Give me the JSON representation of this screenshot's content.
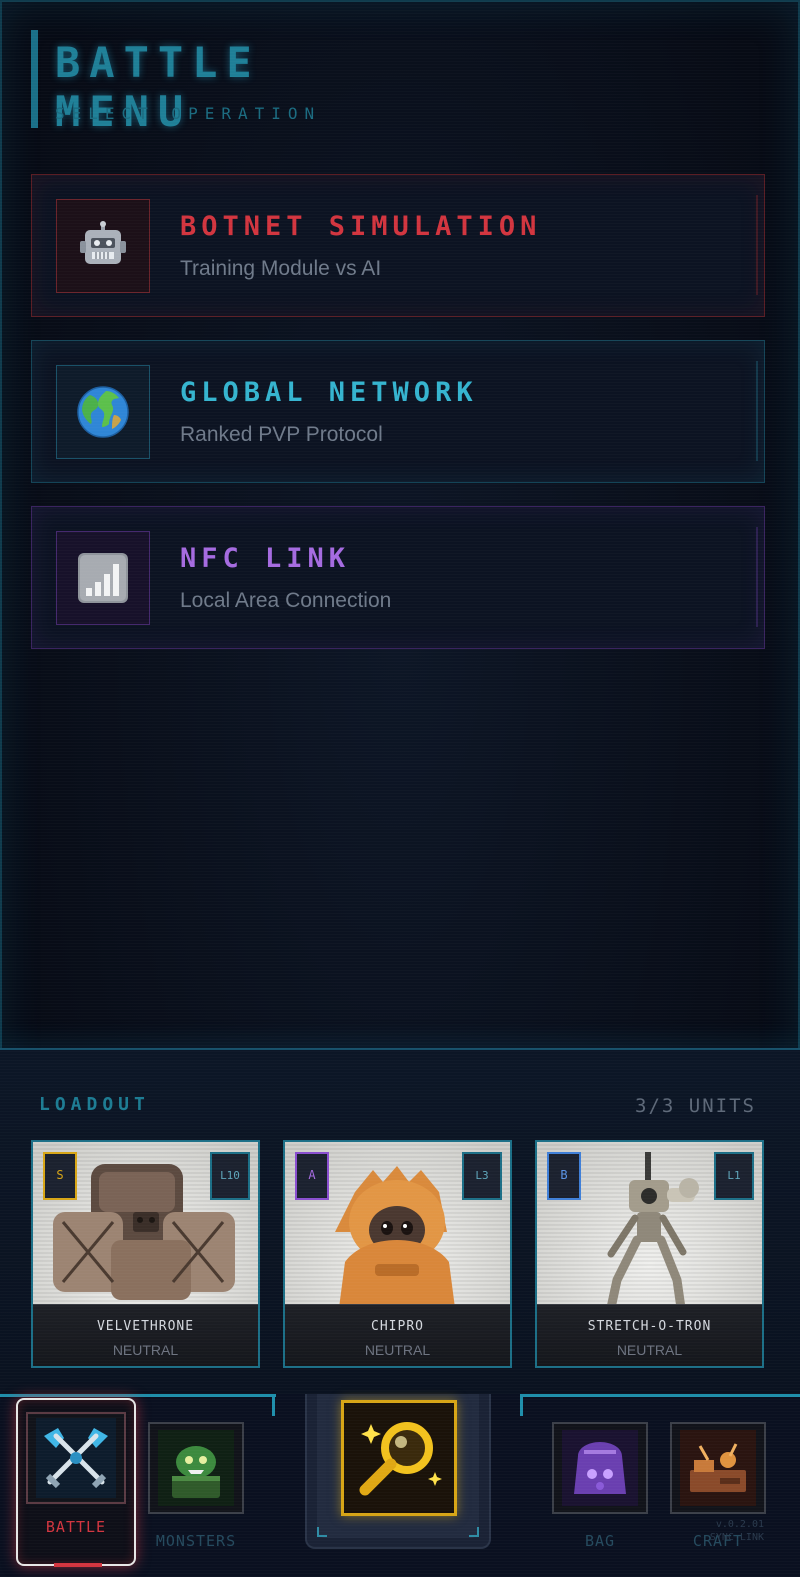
{
  "header": {
    "title": "BATTLE MENU",
    "subtitle": "SELECT OPERATION"
  },
  "modes": [
    {
      "title": "BOTNET SIMULATION",
      "desc": "Training Module vs AI",
      "icon": "robot-icon",
      "color": "#d2353f"
    },
    {
      "title": "GLOBAL NETWORK",
      "desc": "Ranked PVP Protocol",
      "icon": "globe-icon",
      "color": "#35b4cf"
    },
    {
      "title": "NFC LINK",
      "desc": "Local Area Connection",
      "icon": "signal-bars-icon",
      "color": "#a56be0"
    }
  ],
  "loadout": {
    "label": "LOADOUT",
    "count": "3/3 UNITS",
    "units": [
      {
        "rank": "S",
        "level": "L10",
        "name": "VELVETHRONE",
        "type": "NEUTRAL",
        "rank_color": "#d7a516"
      },
      {
        "rank": "A",
        "level": "L3",
        "name": "CHIPRO",
        "type": "NEUTRAL",
        "rank_color": "#a56be0"
      },
      {
        "rank": "B",
        "level": "L1",
        "name": "STRETCH-O-TRON",
        "type": "NEUTRAL",
        "rank_color": "#3f7fd8"
      }
    ]
  },
  "nav": {
    "battle": "BATTLE",
    "monsters": "MONSTERS",
    "bag": "BAG",
    "craft": "CRAFT",
    "version": "v.0.2.01",
    "version_sub": "SYNC LINK"
  }
}
